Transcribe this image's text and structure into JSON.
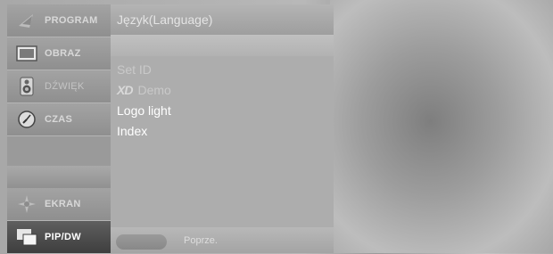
{
  "sidebar": {
    "items": [
      {
        "label": "PROGRAM",
        "icon": "program-icon",
        "state": "normal"
      },
      {
        "label": "OBRAZ",
        "icon": "picture-icon",
        "state": "normal"
      },
      {
        "label": "DŹWIĘK",
        "icon": "speaker-icon",
        "state": "dim"
      },
      {
        "label": "CZAS",
        "icon": "clock-icon",
        "state": "normal"
      },
      {
        "label": "EKRAN",
        "icon": "screen-icon",
        "state": "normal"
      },
      {
        "label": "PIP/DW",
        "icon": "pip-icon",
        "state": "active"
      }
    ]
  },
  "panel": {
    "title": "Język(Language)",
    "items": [
      {
        "label": "Set ID",
        "enabled": false
      },
      {
        "prefix_logo": "XD",
        "label": "Demo",
        "enabled": false
      },
      {
        "label": "Logo light",
        "enabled": true
      },
      {
        "label": "Index",
        "enabled": true
      }
    ],
    "footer": {
      "back_label": "Poprze."
    }
  },
  "colors": {
    "menu_bg": "#a9a9a9",
    "active_item": "#3e3e3e",
    "text": "#ffffff"
  }
}
